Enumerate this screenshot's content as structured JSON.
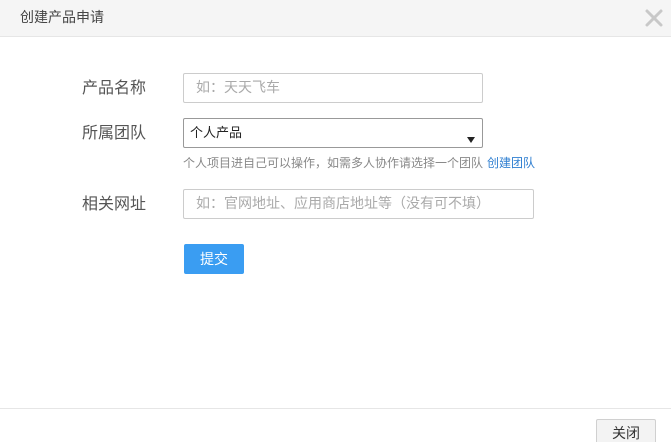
{
  "dialog": {
    "title": "创建产品申请",
    "close_icon": "close-icon"
  },
  "form": {
    "product_name": {
      "label": "产品名称",
      "value": "",
      "placeholder": "如：天天飞车"
    },
    "team": {
      "label": "所属团队",
      "selected": "个人产品",
      "hint": "个人项目进自己可以操作，如需多人协作请选择一个团队",
      "create_team_link": "创建团队"
    },
    "url": {
      "label": "相关网址",
      "value": "",
      "placeholder": "如：官网地址、应用商店地址等（没有可不填）"
    },
    "submit_label": "提交"
  },
  "footer": {
    "close_label": "关闭"
  },
  "colors": {
    "primary": "#3a9df2",
    "link": "#2f7fd1",
    "header_bg": "#f5f5f5"
  }
}
